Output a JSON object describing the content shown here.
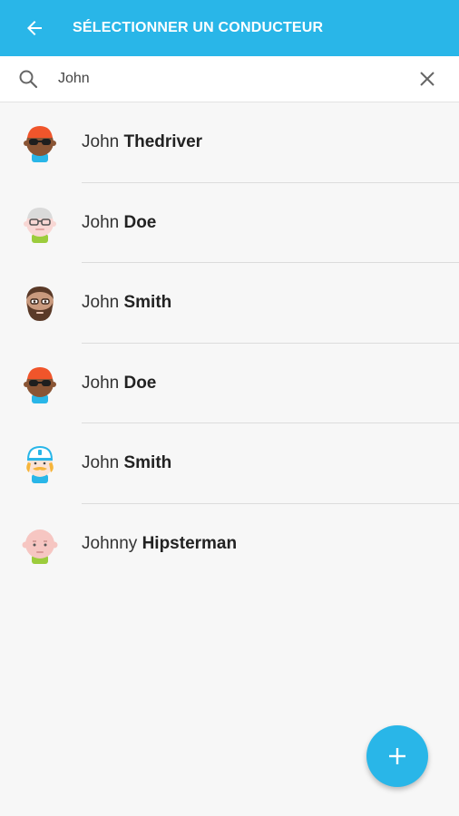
{
  "header": {
    "title": "SÉLECTIONNER UN CONDUCTEUR",
    "back_icon": "arrow-left-icon"
  },
  "search": {
    "value": "John",
    "search_icon": "search-icon",
    "clear_icon": "close-icon"
  },
  "drivers": [
    {
      "first": "John",
      "last": "Thedriver",
      "avatar": "avatar-orange-hair-sunglasses"
    },
    {
      "first": "John",
      "last": "Doe",
      "avatar": "avatar-grey-hair-glasses"
    },
    {
      "first": "John",
      "last": "Smith",
      "avatar": "avatar-bearded"
    },
    {
      "first": "John",
      "last": "Doe",
      "avatar": "avatar-orange-hair-sunglasses"
    },
    {
      "first": "John",
      "last": "Smith",
      "avatar": "avatar-cap-mustache"
    },
    {
      "first": "Johnny",
      "last": "Hipsterman",
      "avatar": "avatar-bald-pink"
    }
  ],
  "fab": {
    "icon": "plus-icon"
  },
  "colors": {
    "primary": "#29b6e8",
    "background": "#f7f7f7"
  }
}
